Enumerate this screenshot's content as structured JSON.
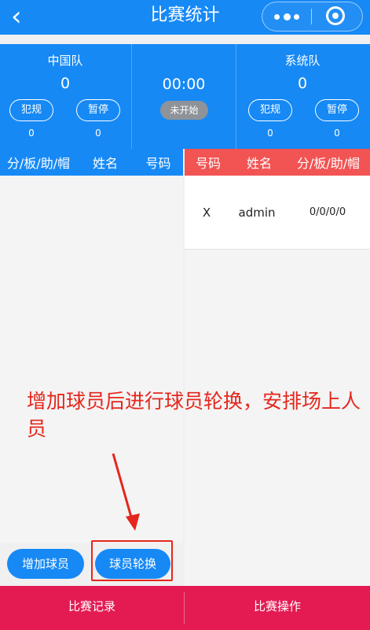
{
  "nav": {
    "title": "比赛统计",
    "back_icon": "chevron-left-icon",
    "more_icon": "more-dots-icon",
    "close_icon": "target-icon"
  },
  "scoreboard": {
    "home": {
      "name": "中国队",
      "score": "0",
      "foul_label": "犯规",
      "foul_count": "0",
      "timeout_label": "暂停",
      "timeout_count": "0"
    },
    "away": {
      "name": "系统队",
      "score": "0",
      "foul_label": "犯规",
      "foul_count": "0",
      "timeout_label": "暂停",
      "timeout_count": "0"
    },
    "clock": "00:00",
    "status": "未开始"
  },
  "left_table": {
    "columns": [
      "分/板/助/帽",
      "姓名",
      "号码"
    ],
    "rows": []
  },
  "right_table": {
    "columns": [
      "号码",
      "姓名",
      "分/板/助/帽"
    ],
    "rows": [
      {
        "number": "X",
        "name": "admin",
        "stats": "0/0/0/0"
      }
    ]
  },
  "annotation": "增加球员后进行球员轮换，安排场上人员",
  "buttons": {
    "add_player": "增加球员",
    "rotate_player": "球员轮换"
  },
  "bottom_tabs": {
    "records": "比赛记录",
    "operations": "比赛操作"
  },
  "colors": {
    "primary": "#1689f5",
    "away_header": "#f25353",
    "bottom_bar": "#e31b52",
    "annotation": "#e5261c"
  }
}
